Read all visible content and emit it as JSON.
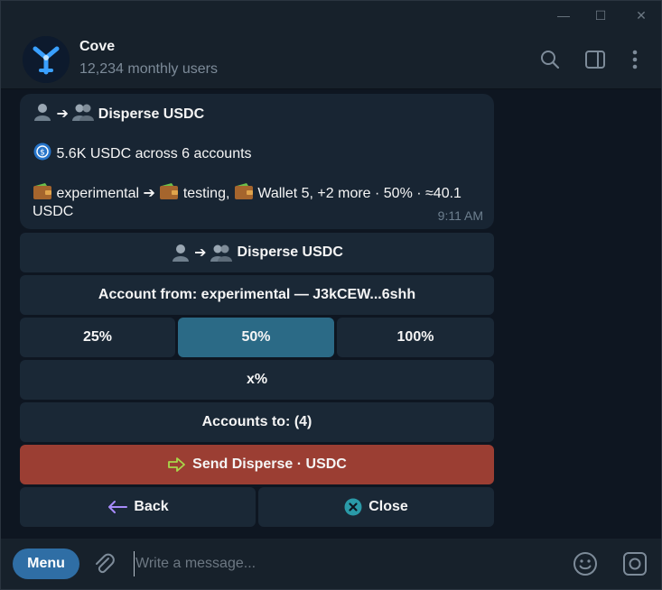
{
  "window": {
    "minimize_glyph": "—",
    "maximize_glyph": "☐",
    "close_glyph": "✕"
  },
  "header": {
    "name": "Cove",
    "subtitle": "12,234 monthly users",
    "icons": [
      "search-icon",
      "sidebar-toggle-icon",
      "more-vertical-icon"
    ]
  },
  "message": {
    "title_arrow": "➔",
    "title_text": "Disperse USDC",
    "summary": "5.6K USDC across 6 accounts",
    "route": {
      "from": "experimental",
      "arrow": "➔",
      "to1": "testing,",
      "to2": "Wallet 5, +2 more · 50% · ≈40.1",
      "tail": "USDC"
    },
    "time": "9:11 AM"
  },
  "keyboard": {
    "title_arrow": "➔",
    "title": "Disperse USDC",
    "account_from": "Account from: experimental — J3kCEW...6shh",
    "pct": [
      "25%",
      "50%",
      "100%"
    ],
    "pct_selected": "50%",
    "custom_pct": "x%",
    "accounts_to": "Accounts to: (4)",
    "send": "Send Disperse · USDC",
    "back": "Back",
    "close": "Close"
  },
  "composer": {
    "menu_label": "Menu",
    "placeholder": "Write a message...",
    "icons": [
      "attach-icon",
      "emoji-icon",
      "camera-icon"
    ]
  },
  "colors": {
    "bg": "#0e1621",
    "panel": "#17212b",
    "bubble": "#182533",
    "button": "#1a2836",
    "selected": "#2b6a86",
    "send": "#9b3e33",
    "menu": "#2f6ea5"
  }
}
